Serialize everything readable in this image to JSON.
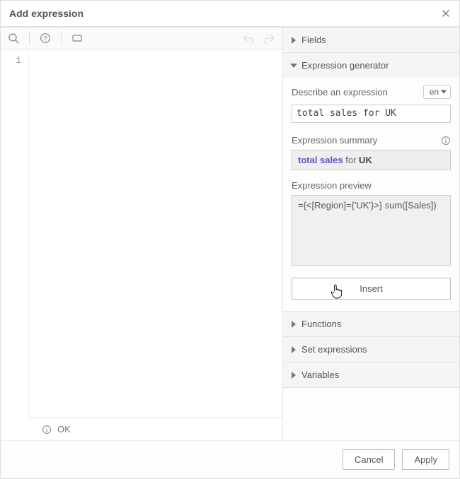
{
  "header": {
    "title": "Add expression"
  },
  "editor": {
    "gutter_line": "1"
  },
  "status": {
    "ok": "OK"
  },
  "sidebar": {
    "fields": {
      "label": "Fields"
    },
    "generator": {
      "label": "Expression generator",
      "describe_label": "Describe an expression",
      "lang": "en",
      "desc_value": "total sales for UK",
      "summary_label": "Expression summary",
      "summary_parts": {
        "a": "total sales",
        "mid": " for ",
        "b": "UK"
      },
      "preview_label": "Expression preview",
      "preview_value": "={<[Region]={'UK'}>} sum([Sales])",
      "insert_label": "Insert"
    },
    "functions": {
      "label": "Functions"
    },
    "setexpr": {
      "label": "Set expressions"
    },
    "variables": {
      "label": "Variables"
    }
  },
  "footer": {
    "cancel": "Cancel",
    "apply": "Apply"
  }
}
